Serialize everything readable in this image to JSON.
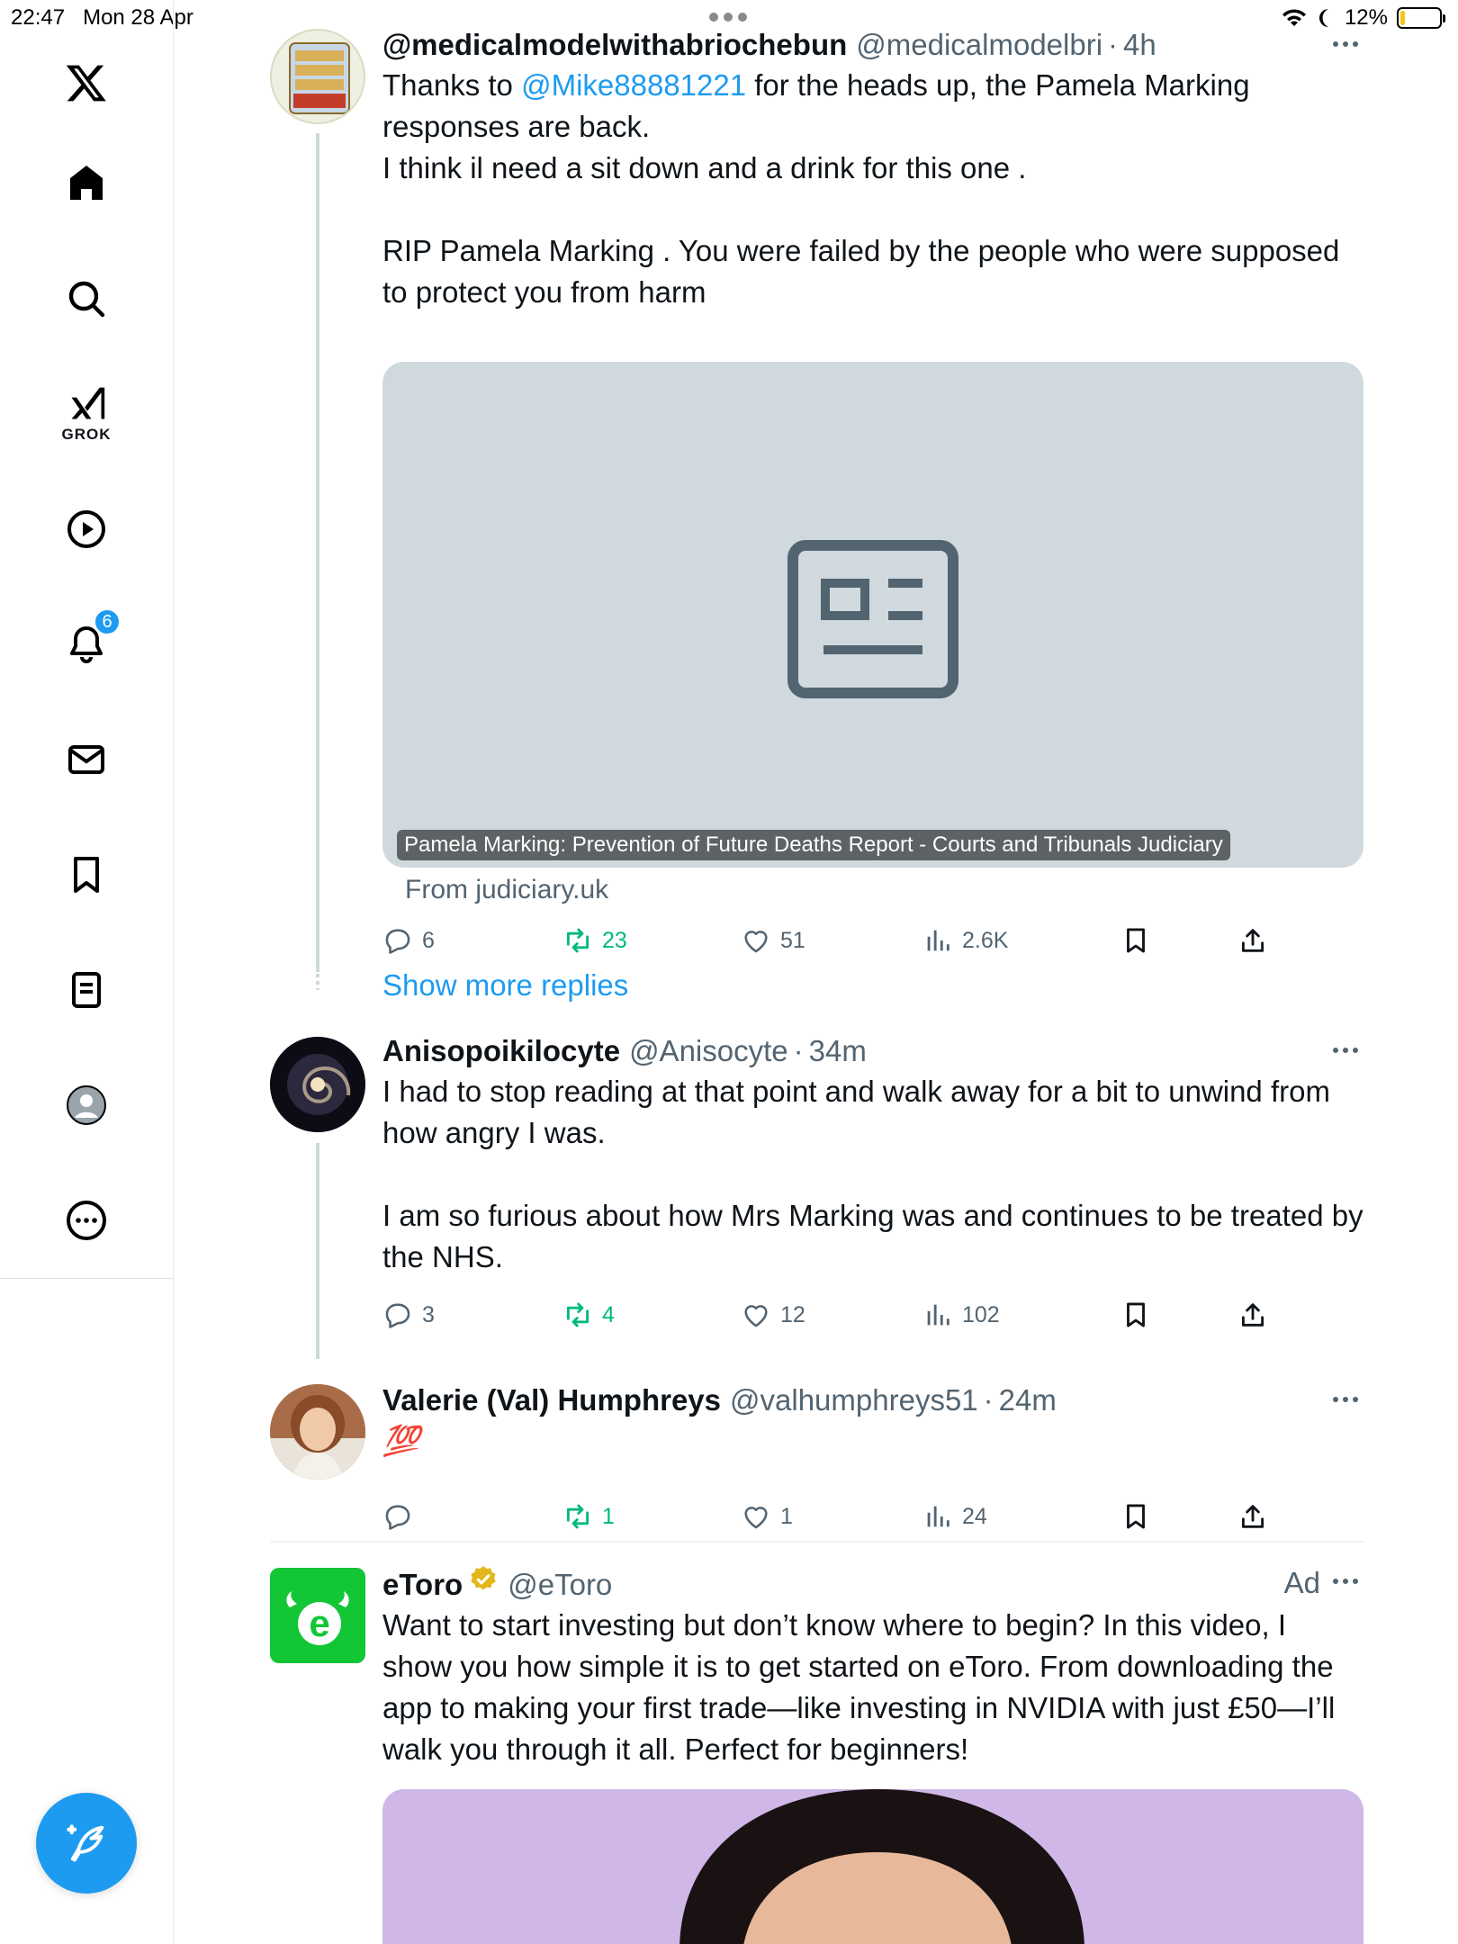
{
  "status_bar": {
    "time": "22:47",
    "date": "Mon 28 Apr",
    "battery": "12%",
    "battery_level": 0.12
  },
  "sidebar": {
    "grok_label": "GROK",
    "notifications_count": "6",
    "accent_color": "#1d9bf0"
  },
  "tweets": [
    {
      "display_name": "@medicalmodelwithabriochebun",
      "handle": "@medicalmodelbri",
      "time": "4h",
      "text_before": "Thanks to ",
      "mention": "@Mike88881221",
      "text_after": " for the heads up, the Pamela Marking responses are back.\nI think il need a sit down and a drink for this one .\n\nRIP Pamela Marking . You were failed by the people who were supposed to protect you from harm",
      "card_title": "Pamela Marking: Prevention of Future Deaths Report - Courts and Tribunals Judiciary",
      "card_from": "From judiciary.uk",
      "replies": "6",
      "reposts": "23",
      "likes": "51",
      "views": "2.6K"
    },
    {
      "display_name": "Anisopoikilocyte",
      "handle": "@Anisocyte",
      "time": "34m",
      "text": "I had to stop reading at that point and walk away for a bit to unwind from how angry I was.\n\nI am so furious about how Mrs Marking was and continues to be treated by the NHS.",
      "replies": "3",
      "reposts": "4",
      "likes": "12",
      "views": "102"
    },
    {
      "display_name": "Valerie (Val) Humphreys",
      "handle": "@valhumphreys51",
      "time": "24m",
      "text": "💯",
      "replies": "",
      "reposts": "1",
      "likes": "1",
      "views": "24"
    },
    {
      "display_name": "eToro",
      "handle": "@eToro",
      "ad_label": "Ad",
      "text": "Want to start investing but don’t know where to begin? In this video, I show you how simple it is to get started on eToro. From downloading the app to making your first trade—like investing in NVIDIA with just £50—I’ll walk you through it all. Perfect for beginners!"
    }
  ],
  "show_more_replies": "Show more replies"
}
